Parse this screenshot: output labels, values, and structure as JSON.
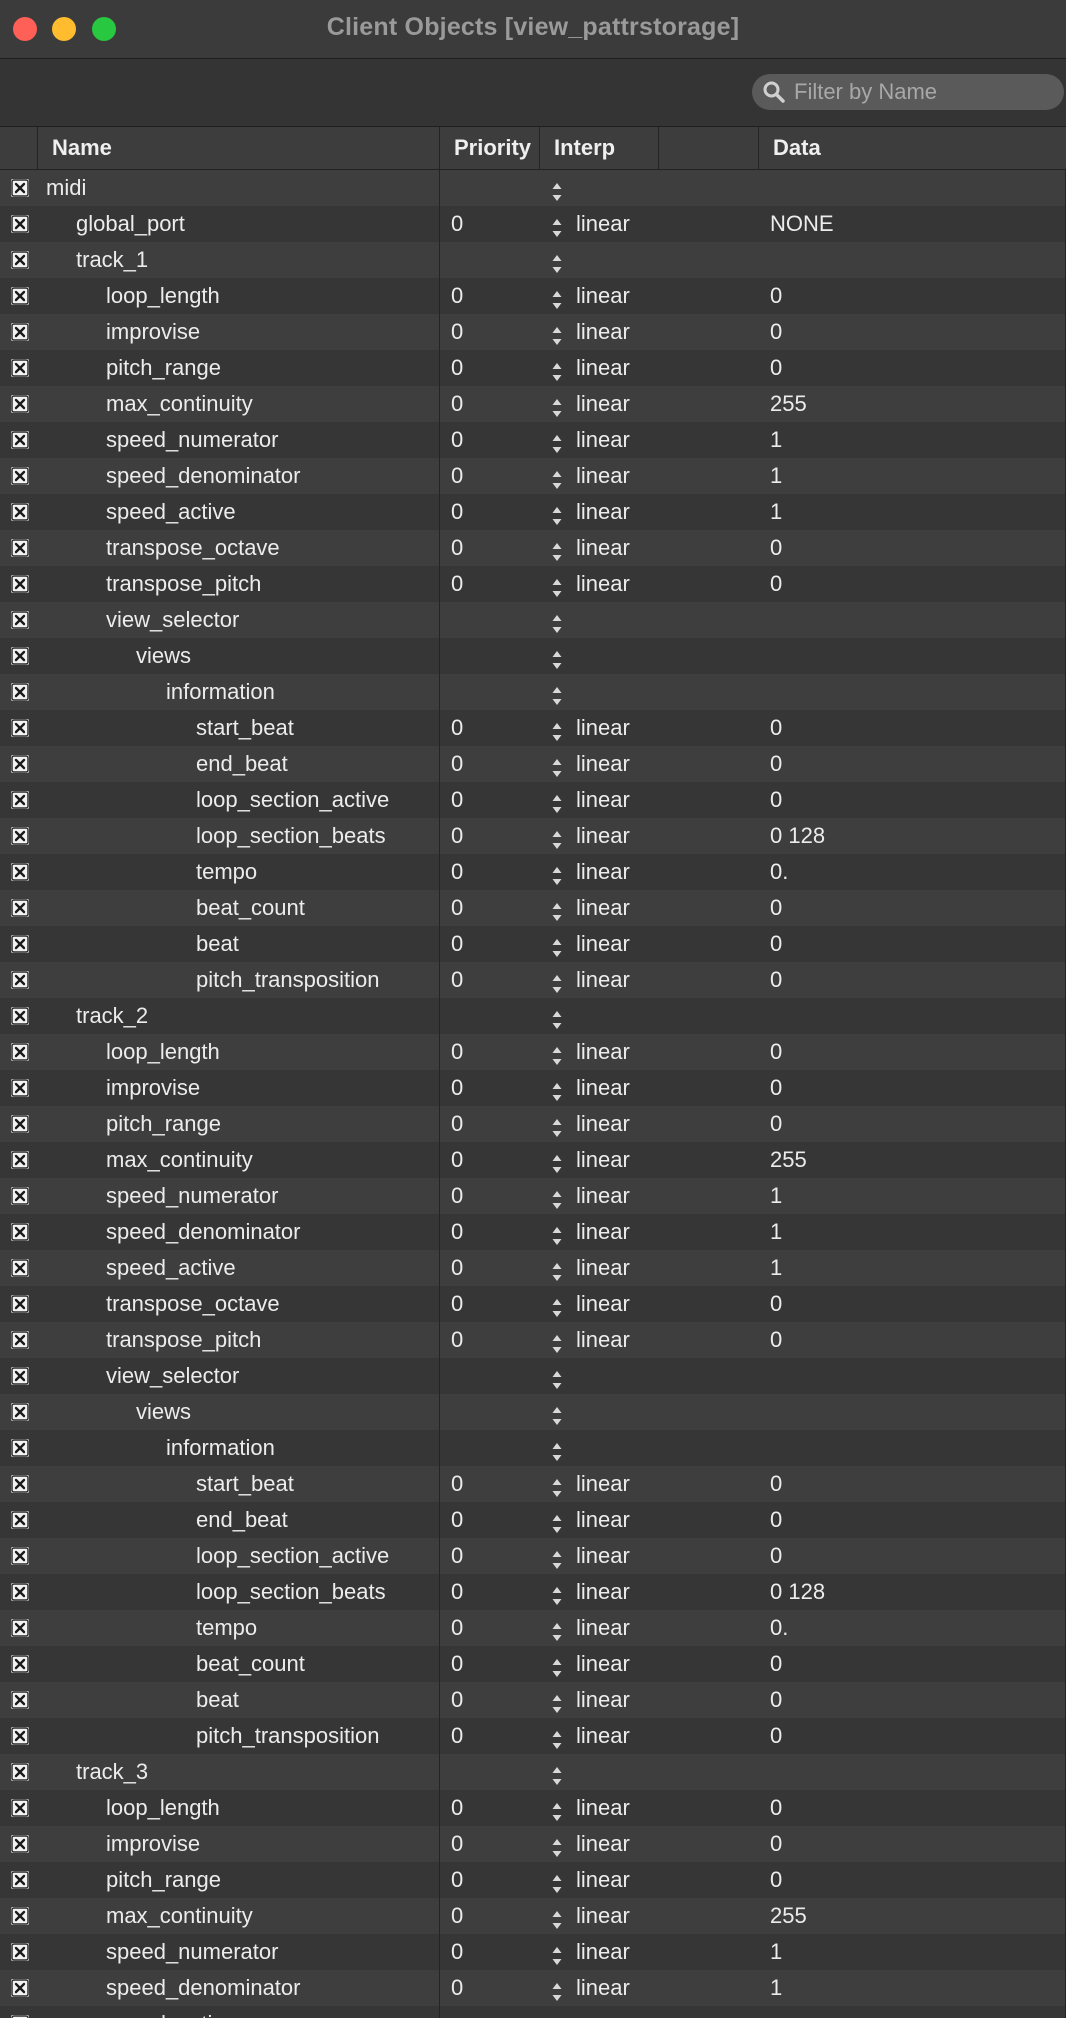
{
  "window": {
    "title": "Client Objects [view_pattrstorage]",
    "search_placeholder": "Filter by Name",
    "search_value": ""
  },
  "columns": {
    "name": "Name",
    "priority": "Priority",
    "interp": "Interp",
    "blank": "",
    "data": "Data"
  },
  "rows": [
    {
      "name": "midi",
      "depth": 0,
      "priority": "",
      "interp": "",
      "data": ""
    },
    {
      "name": "global_port",
      "depth": 1,
      "priority": "0",
      "interp": "linear",
      "data": "NONE"
    },
    {
      "name": "track_1",
      "depth": 1,
      "priority": "",
      "interp": "",
      "data": ""
    },
    {
      "name": "loop_length",
      "depth": 2,
      "priority": "0",
      "interp": "linear",
      "data": "0"
    },
    {
      "name": "improvise",
      "depth": 2,
      "priority": "0",
      "interp": "linear",
      "data": "0"
    },
    {
      "name": "pitch_range",
      "depth": 2,
      "priority": "0",
      "interp": "linear",
      "data": "0"
    },
    {
      "name": "max_continuity",
      "depth": 2,
      "priority": "0",
      "interp": "linear",
      "data": "255"
    },
    {
      "name": "speed_numerator",
      "depth": 2,
      "priority": "0",
      "interp": "linear",
      "data": "1"
    },
    {
      "name": "speed_denominator",
      "depth": 2,
      "priority": "0",
      "interp": "linear",
      "data": "1"
    },
    {
      "name": "speed_active",
      "depth": 2,
      "priority": "0",
      "interp": "linear",
      "data": "1"
    },
    {
      "name": "transpose_octave",
      "depth": 2,
      "priority": "0",
      "interp": "linear",
      "data": "0"
    },
    {
      "name": "transpose_pitch",
      "depth": 2,
      "priority": "0",
      "interp": "linear",
      "data": "0"
    },
    {
      "name": "view_selector",
      "depth": 2,
      "priority": "",
      "interp": "",
      "data": ""
    },
    {
      "name": "views",
      "depth": 3,
      "priority": "",
      "interp": "",
      "data": ""
    },
    {
      "name": "information",
      "depth": 4,
      "priority": "",
      "interp": "",
      "data": ""
    },
    {
      "name": "start_beat",
      "depth": 5,
      "priority": "0",
      "interp": "linear",
      "data": "0"
    },
    {
      "name": "end_beat",
      "depth": 5,
      "priority": "0",
      "interp": "linear",
      "data": "0"
    },
    {
      "name": "loop_section_active",
      "depth": 5,
      "priority": "0",
      "interp": "linear",
      "data": "0"
    },
    {
      "name": "loop_section_beats",
      "depth": 5,
      "priority": "0",
      "interp": "linear",
      "data": "0 128"
    },
    {
      "name": "tempo",
      "depth": 5,
      "priority": "0",
      "interp": "linear",
      "data": "0."
    },
    {
      "name": "beat_count",
      "depth": 5,
      "priority": "0",
      "interp": "linear",
      "data": "0"
    },
    {
      "name": "beat",
      "depth": 5,
      "priority": "0",
      "interp": "linear",
      "data": "0"
    },
    {
      "name": "pitch_transposition",
      "depth": 5,
      "priority": "0",
      "interp": "linear",
      "data": "0"
    },
    {
      "name": "track_2",
      "depth": 1,
      "priority": "",
      "interp": "",
      "data": ""
    },
    {
      "name": "loop_length",
      "depth": 2,
      "priority": "0",
      "interp": "linear",
      "data": "0"
    },
    {
      "name": "improvise",
      "depth": 2,
      "priority": "0",
      "interp": "linear",
      "data": "0"
    },
    {
      "name": "pitch_range",
      "depth": 2,
      "priority": "0",
      "interp": "linear",
      "data": "0"
    },
    {
      "name": "max_continuity",
      "depth": 2,
      "priority": "0",
      "interp": "linear",
      "data": "255"
    },
    {
      "name": "speed_numerator",
      "depth": 2,
      "priority": "0",
      "interp": "linear",
      "data": "1"
    },
    {
      "name": "speed_denominator",
      "depth": 2,
      "priority": "0",
      "interp": "linear",
      "data": "1"
    },
    {
      "name": "speed_active",
      "depth": 2,
      "priority": "0",
      "interp": "linear",
      "data": "1"
    },
    {
      "name": "transpose_octave",
      "depth": 2,
      "priority": "0",
      "interp": "linear",
      "data": "0"
    },
    {
      "name": "transpose_pitch",
      "depth": 2,
      "priority": "0",
      "interp": "linear",
      "data": "0"
    },
    {
      "name": "view_selector",
      "depth": 2,
      "priority": "",
      "interp": "",
      "data": ""
    },
    {
      "name": "views",
      "depth": 3,
      "priority": "",
      "interp": "",
      "data": ""
    },
    {
      "name": "information",
      "depth": 4,
      "priority": "",
      "interp": "",
      "data": ""
    },
    {
      "name": "start_beat",
      "depth": 5,
      "priority": "0",
      "interp": "linear",
      "data": "0"
    },
    {
      "name": "end_beat",
      "depth": 5,
      "priority": "0",
      "interp": "linear",
      "data": "0"
    },
    {
      "name": "loop_section_active",
      "depth": 5,
      "priority": "0",
      "interp": "linear",
      "data": "0"
    },
    {
      "name": "loop_section_beats",
      "depth": 5,
      "priority": "0",
      "interp": "linear",
      "data": "0 128"
    },
    {
      "name": "tempo",
      "depth": 5,
      "priority": "0",
      "interp": "linear",
      "data": "0."
    },
    {
      "name": "beat_count",
      "depth": 5,
      "priority": "0",
      "interp": "linear",
      "data": "0"
    },
    {
      "name": "beat",
      "depth": 5,
      "priority": "0",
      "interp": "linear",
      "data": "0"
    },
    {
      "name": "pitch_transposition",
      "depth": 5,
      "priority": "0",
      "interp": "linear",
      "data": "0"
    },
    {
      "name": "track_3",
      "depth": 1,
      "priority": "",
      "interp": "",
      "data": ""
    },
    {
      "name": "loop_length",
      "depth": 2,
      "priority": "0",
      "interp": "linear",
      "data": "0"
    },
    {
      "name": "improvise",
      "depth": 2,
      "priority": "0",
      "interp": "linear",
      "data": "0"
    },
    {
      "name": "pitch_range",
      "depth": 2,
      "priority": "0",
      "interp": "linear",
      "data": "0"
    },
    {
      "name": "max_continuity",
      "depth": 2,
      "priority": "0",
      "interp": "linear",
      "data": "255"
    },
    {
      "name": "speed_numerator",
      "depth": 2,
      "priority": "0",
      "interp": "linear",
      "data": "1"
    },
    {
      "name": "speed_denominator",
      "depth": 2,
      "priority": "0",
      "interp": "linear",
      "data": "1"
    },
    {
      "name": "speed_active",
      "depth": 2,
      "priority": "",
      "interp": "",
      "data": ""
    }
  ]
}
